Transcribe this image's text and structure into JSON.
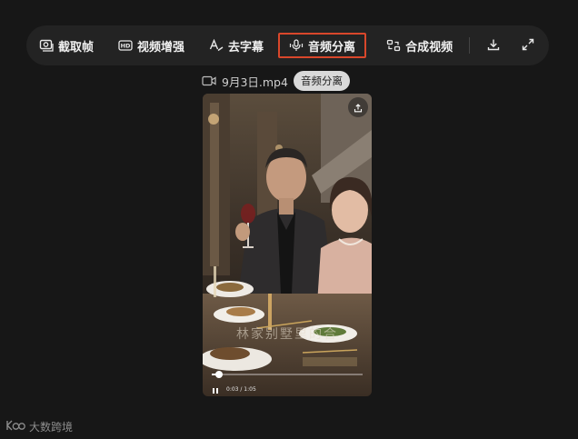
{
  "toolbar": {
    "items": [
      {
        "label": "截取帧",
        "icon": "capture-frame-icon"
      },
      {
        "label": "视频增强",
        "icon": "hd-icon"
      },
      {
        "label": "去字幕",
        "icon": "text-remove-icon"
      },
      {
        "label": "音频分离",
        "icon": "audio-split-icon",
        "selected": true
      },
      {
        "label": "合成视频",
        "icon": "merge-video-icon"
      }
    ],
    "download_icon": "download-icon",
    "expand_icon": "expand-icon",
    "accent_color": "#d9472b"
  },
  "file": {
    "name": "9月3日.mp4",
    "tag": "音频分离"
  },
  "video": {
    "caption": "林家别墅里的合",
    "time": "0:03 / 1:05",
    "progress": 0.05,
    "share_icon": "share-icon"
  },
  "watermark": {
    "logo": "KOO",
    "text": "大数跨境"
  }
}
